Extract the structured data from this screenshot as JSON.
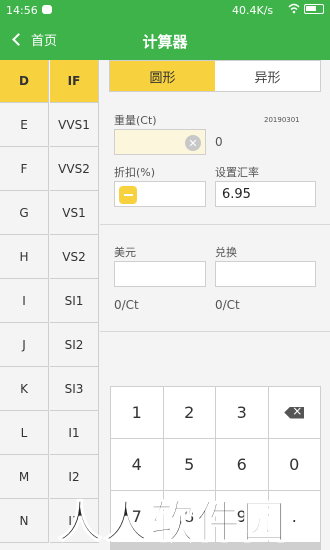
{
  "statusbar": {
    "time": "14:56",
    "speed": "40.4K/s"
  },
  "header": {
    "back_label": "首页",
    "title": "计算器"
  },
  "grades": {
    "color": [
      "D",
      "E",
      "F",
      "G",
      "H",
      "I",
      "J",
      "K",
      "L",
      "M",
      "N"
    ],
    "clarity": [
      "IF",
      "VVS1",
      "VVS2",
      "VS1",
      "VS2",
      "SI1",
      "SI2",
      "SI3",
      "I1",
      "I2",
      "I3"
    ],
    "selected_color": "D",
    "selected_clarity": "IF"
  },
  "tabs": {
    "round": "圆形",
    "fancy": "异形",
    "active": "round"
  },
  "form": {
    "weight_label": "重量(Ct)",
    "version": "20190301",
    "weight_value": "",
    "weight_result": "0",
    "discount_label": "折扣(%)",
    "rate_label": "设置汇率",
    "rate_value": "6.95",
    "usd_label": "美元",
    "exchange_label": "兑换",
    "usd_unit": "0/Ct",
    "exchange_unit": "0/Ct"
  },
  "keypad": {
    "keys": [
      "1",
      "2",
      "3",
      "⌫",
      "4",
      "5",
      "6",
      "0",
      "7",
      "8",
      "9",
      "."
    ]
  },
  "watermark": "人人软件园",
  "colors": {
    "brand_green": "#3eb34a",
    "accent_yellow": "#f7d23e"
  }
}
